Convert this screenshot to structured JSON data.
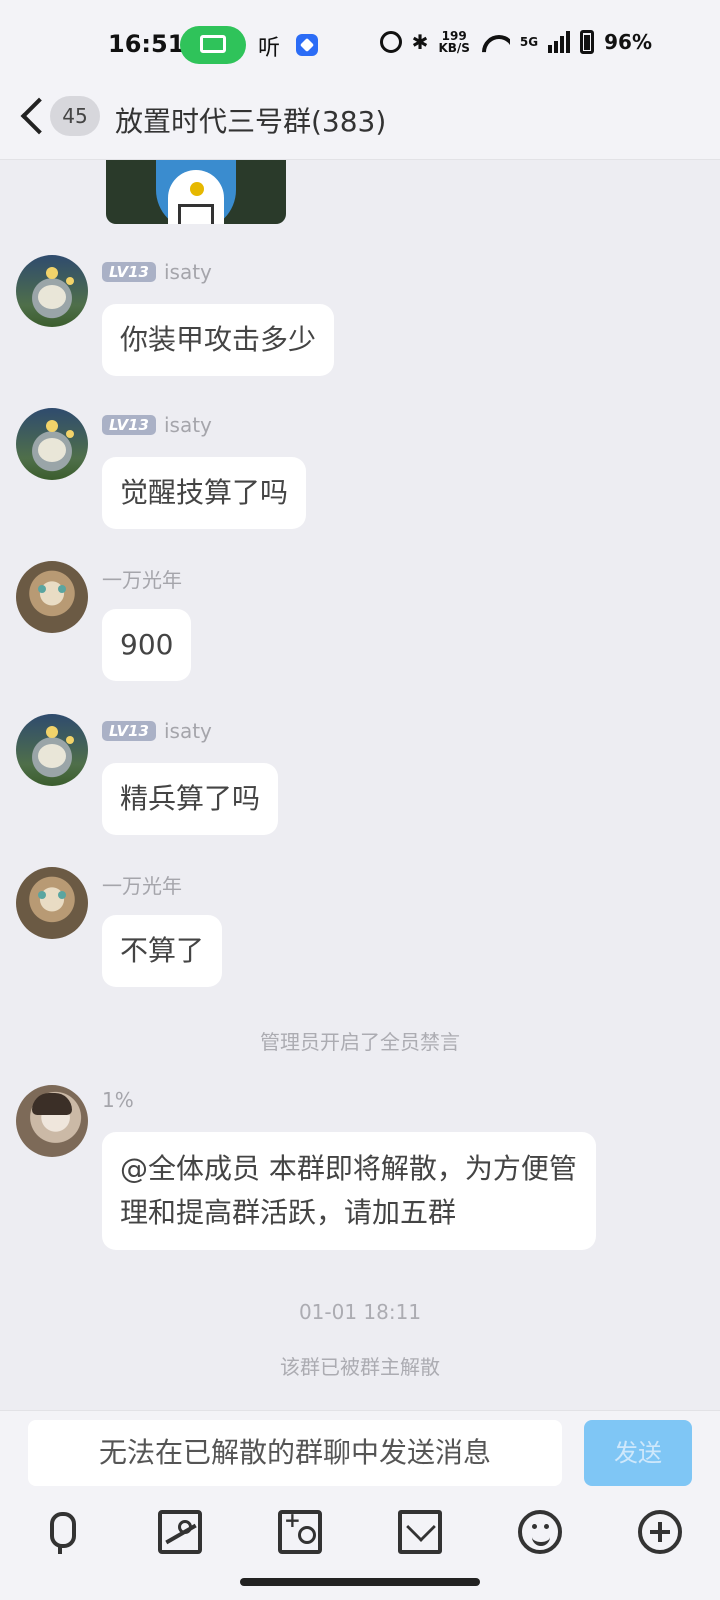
{
  "status_bar": {
    "time": "16:51",
    "app_label": "听",
    "speed_value": "199",
    "speed_unit": "KB/S",
    "network": "5G",
    "battery": "96%"
  },
  "header": {
    "unread_count": "45",
    "title": "放置时代三号群(383)"
  },
  "messages": [
    {
      "level": "LV13",
      "nick": "isaty",
      "text": "你装甲攻击多少",
      "avatar": "totoro-avatar"
    },
    {
      "level": "LV13",
      "nick": "isaty",
      "text": "觉醒技算了吗",
      "avatar": "totoro-avatar"
    },
    {
      "level": "",
      "nick": "一万光年",
      "text": "900",
      "avatar": "cat-avatar"
    },
    {
      "level": "LV13",
      "nick": "isaty",
      "text": "精兵算了吗",
      "avatar": "totoro-avatar"
    },
    {
      "level": "",
      "nick": "一万光年",
      "text": "不算了",
      "avatar": "cat-avatar"
    }
  ],
  "system_mute": "管理员开启了全员禁言",
  "announcement": {
    "nick": "1%",
    "text": "@全体成员 本群即将解散，为方便管理和提高群活跃，请加五群"
  },
  "timestamp": "01-01 18:11",
  "system_dissolved": "该群已被群主解散",
  "input": {
    "placeholder": "无法在已解散的群聊中发送消息",
    "send_label": "发送"
  },
  "toolbar_icons": [
    "mic-icon",
    "image-icon",
    "camera-icon",
    "red-packet-icon",
    "emoji-icon",
    "plus-icon"
  ],
  "colors": {
    "background": "#ededf2",
    "send_button": "#7fc6f5",
    "level_badge": "#aab1c6",
    "status_pill": "#2fc35a"
  }
}
